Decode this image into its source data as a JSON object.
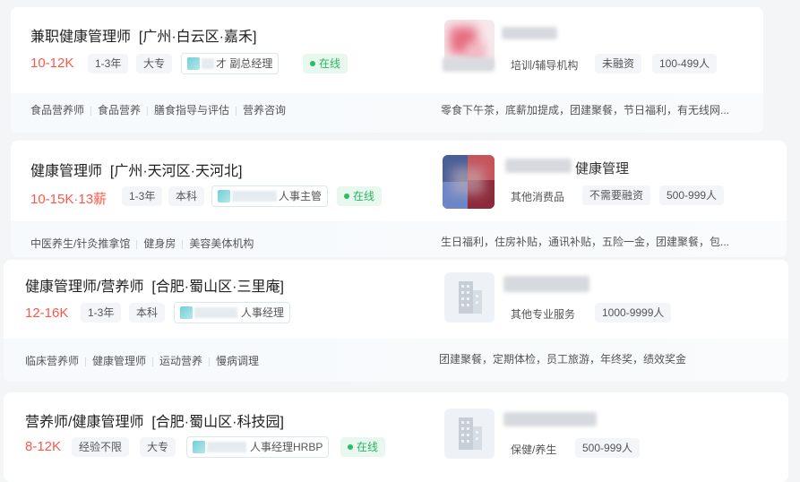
{
  "jobs": [
    {
      "title": "兼职健康管理师",
      "location": "[广州·白云区·嘉禾]",
      "salary": "10-12K",
      "experience": "1-3年",
      "education": "大专",
      "recruiter": "才 副总经理",
      "online": "在线",
      "skills": [
        "食品营养师",
        "食品营养",
        "膳食指导与评估",
        "营养咨询"
      ],
      "company_name_visible": "",
      "company_tags": [
        "培训/辅导机构",
        "未融资",
        "100-499人"
      ],
      "benefits": "零食下午茶，底薪加提成，团建聚餐，节日福利，有无线网..."
    },
    {
      "title": "健康管理师",
      "location": "[广州·天河区·天河北]",
      "salary": "10-15K·13薪",
      "experience": "1-3年",
      "education": "本科",
      "recruiter": "人事主管",
      "online": "在线",
      "skills": [
        "中医养生/针灸推拿馆",
        "健身房",
        "美容美体机构"
      ],
      "company_name_visible": "健康管理",
      "company_tags": [
        "其他消费品",
        "不需要融资",
        "500-999人"
      ],
      "benefits": "生日福利，住房补贴，通讯补贴，五险一金，团建聚餐，包..."
    },
    {
      "title": "健康管理师/营养师",
      "location": "[合肥·蜀山区·三里庵]",
      "salary": "12-16K",
      "experience": "1-3年",
      "education": "本科",
      "recruiter": "人事经理",
      "online": "",
      "skills": [
        "临床营养师",
        "健康管理师",
        "运动营养",
        "慢病调理"
      ],
      "company_name_visible": "",
      "company_tags": [
        "其他专业服务",
        "1000-9999人"
      ],
      "benefits": "团建聚餐，定期体检，员工旅游，年终奖，绩效奖金"
    },
    {
      "title": "营养师/健康管理师",
      "location": "[合肥·蜀山区·科技园]",
      "salary": "8-12K",
      "experience": "经验不限",
      "education": "大专",
      "recruiter": "人事经理HRBP",
      "online": "在线",
      "skills": [],
      "company_name_visible": "",
      "company_tags": [
        "保健/养生",
        "500-999人"
      ],
      "benefits": ""
    }
  ]
}
